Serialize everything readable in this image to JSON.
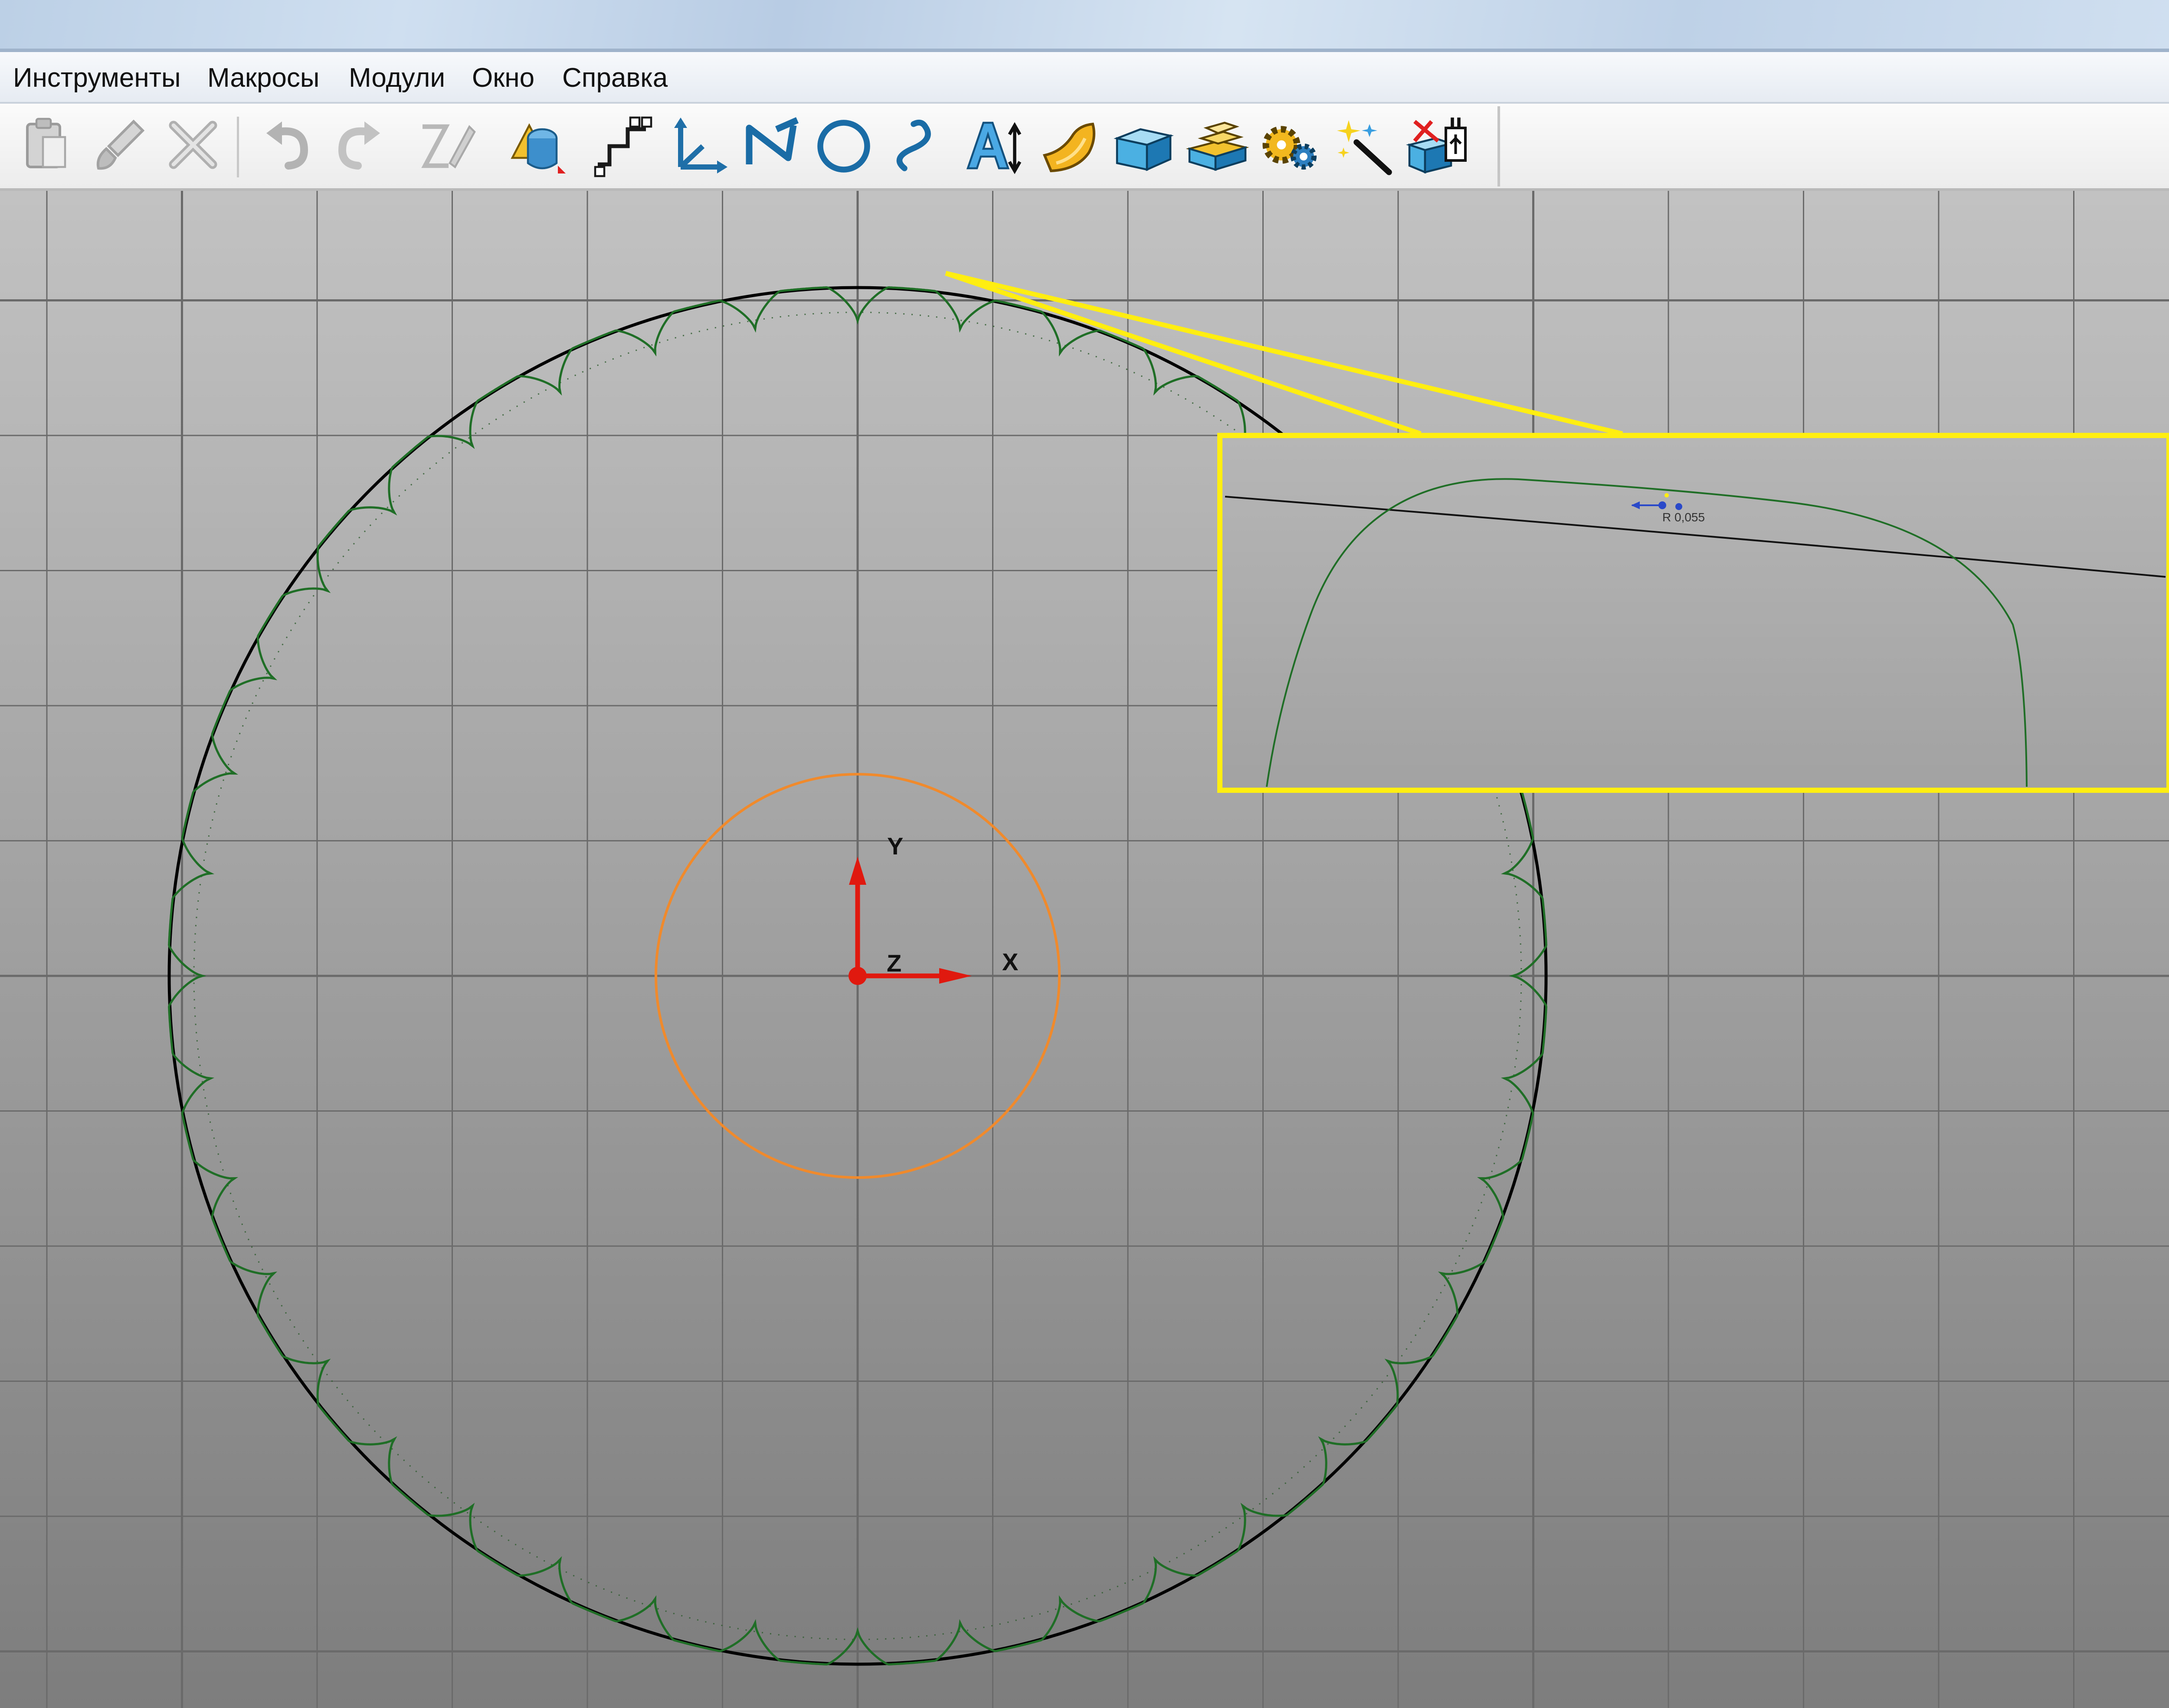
{
  "menubar": {
    "items": [
      {
        "label": "Инструменты"
      },
      {
        "label": "Макросы"
      },
      {
        "label": "Модули"
      },
      {
        "label": "Окно"
      },
      {
        "label": "Справка"
      }
    ]
  },
  "toolbar": {
    "buttons": [
      {
        "icon": "paste-icon",
        "enabled": false
      },
      {
        "icon": "brush-icon",
        "enabled": false
      },
      {
        "icon": "delete-icon",
        "enabled": false
      },
      {
        "icon": "undo-icon",
        "enabled": false
      },
      {
        "icon": "redo-icon",
        "enabled": false
      },
      {
        "icon": "edit-pen-icon",
        "enabled": false
      },
      {
        "icon": "primitives-icon",
        "enabled": true
      },
      {
        "icon": "workplane-icon",
        "enabled": true
      },
      {
        "icon": "axes-icon",
        "enabled": true
      },
      {
        "icon": "polyline-icon",
        "enabled": true
      },
      {
        "icon": "circle-icon",
        "enabled": true
      },
      {
        "icon": "curve-icon",
        "enabled": true
      },
      {
        "icon": "text-icon",
        "enabled": true
      },
      {
        "icon": "surface-icon",
        "enabled": true
      },
      {
        "icon": "solid-block-icon",
        "enabled": true
      },
      {
        "icon": "layer-stack-icon",
        "enabled": true
      },
      {
        "icon": "gears-icon",
        "enabled": true
      },
      {
        "icon": "magic-wand-icon",
        "enabled": true
      },
      {
        "icon": "machine-export-icon",
        "enabled": true
      }
    ]
  },
  "viewport": {
    "axis_labels": {
      "y": "Y",
      "z": "Z",
      "x": "X"
    },
    "zoom_inset": {
      "radius_label": "R 0,055"
    },
    "gear": {
      "tooth_count": 40
    },
    "colors": {
      "background_top": "#c2c2c2",
      "background_bottom": "#7d7d7d",
      "grid": "#6a6a6a",
      "outer_circle": "#000000",
      "tooth_profile": "#1f6e26",
      "center_circle": "#f08a2c",
      "axes": "#e0190f",
      "callout": "#ffee11"
    }
  }
}
